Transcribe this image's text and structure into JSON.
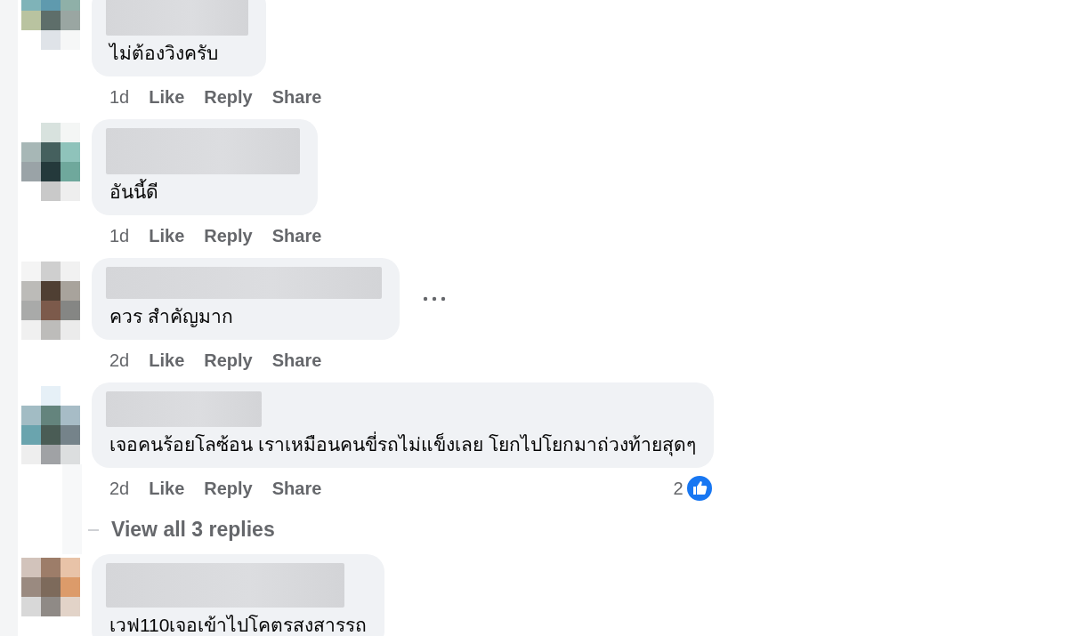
{
  "comments": [
    {
      "text": "ไม่ต้องวิงครับ",
      "time": "1d",
      "actions": [
        "Like",
        "Reply",
        "Share"
      ],
      "more_menu": false
    },
    {
      "text": "อันนี้ดี",
      "time": "1d",
      "actions": [
        "Like",
        "Reply",
        "Share"
      ],
      "more_menu": false
    },
    {
      "text": "ควร สำคัญมาก",
      "time": "2d",
      "actions": [
        "Like",
        "Reply",
        "Share"
      ],
      "more_menu": true
    },
    {
      "text": "เจอคนร้อยโลซ้อน เราเหมือนคนขี่รถไม่แข็งเลย โยกไปโยกมาถ่วงท้ายสุดๆ",
      "time": "2d",
      "actions": [
        "Like",
        "Reply",
        "Share"
      ],
      "more_menu": false,
      "reaction_count": "2",
      "replies_link": "View all 3 replies"
    },
    {
      "text": "เวฟ110เจอเข้าไปโคตรสงสารรถ",
      "more_menu": false
    }
  ]
}
